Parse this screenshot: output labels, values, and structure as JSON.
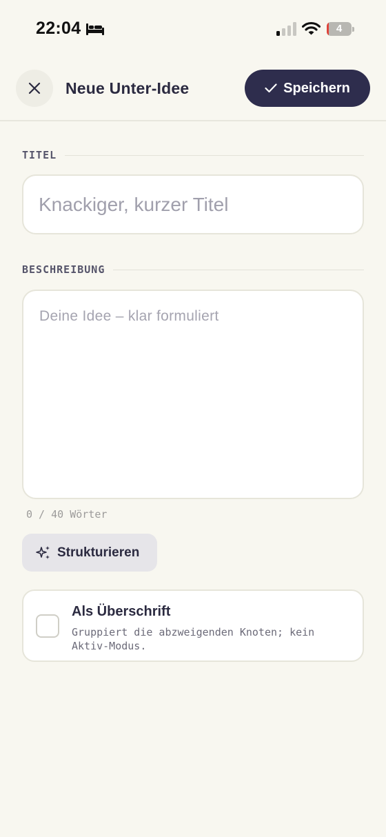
{
  "status_bar": {
    "time": "22:04",
    "battery_level": "4",
    "battery_fraction": 0.04,
    "focus_icon": "bed-icon",
    "signal_icon": "cellular-signal-icon",
    "wifi_icon": "wifi-icon"
  },
  "header": {
    "close_icon": "close-icon",
    "title": "Neue Unter-Idee",
    "save_label": "Speichern",
    "save_icon": "checkmark-icon"
  },
  "form": {
    "title_section_label": "TITEL",
    "title_placeholder": "Knackiger, kurzer Titel",
    "title_value": "",
    "description_section_label": "BESCHREIBUNG",
    "description_placeholder": "Deine Idee – klar formuliert",
    "description_value": "",
    "word_count": "0 / 40 Wörter",
    "structure_button_label": "Strukturieren",
    "structure_icon": "sparkles-icon",
    "heading_option": {
      "label": "Als Überschrift",
      "description": "Gruppiert die abzweigenden Knoten; kein Aktiv-Modus.",
      "checked": false
    }
  },
  "colors": {
    "background": "#f8f7f0",
    "primary": "#2e2d4d",
    "card": "#ffffff",
    "border": "#e6e5da"
  }
}
